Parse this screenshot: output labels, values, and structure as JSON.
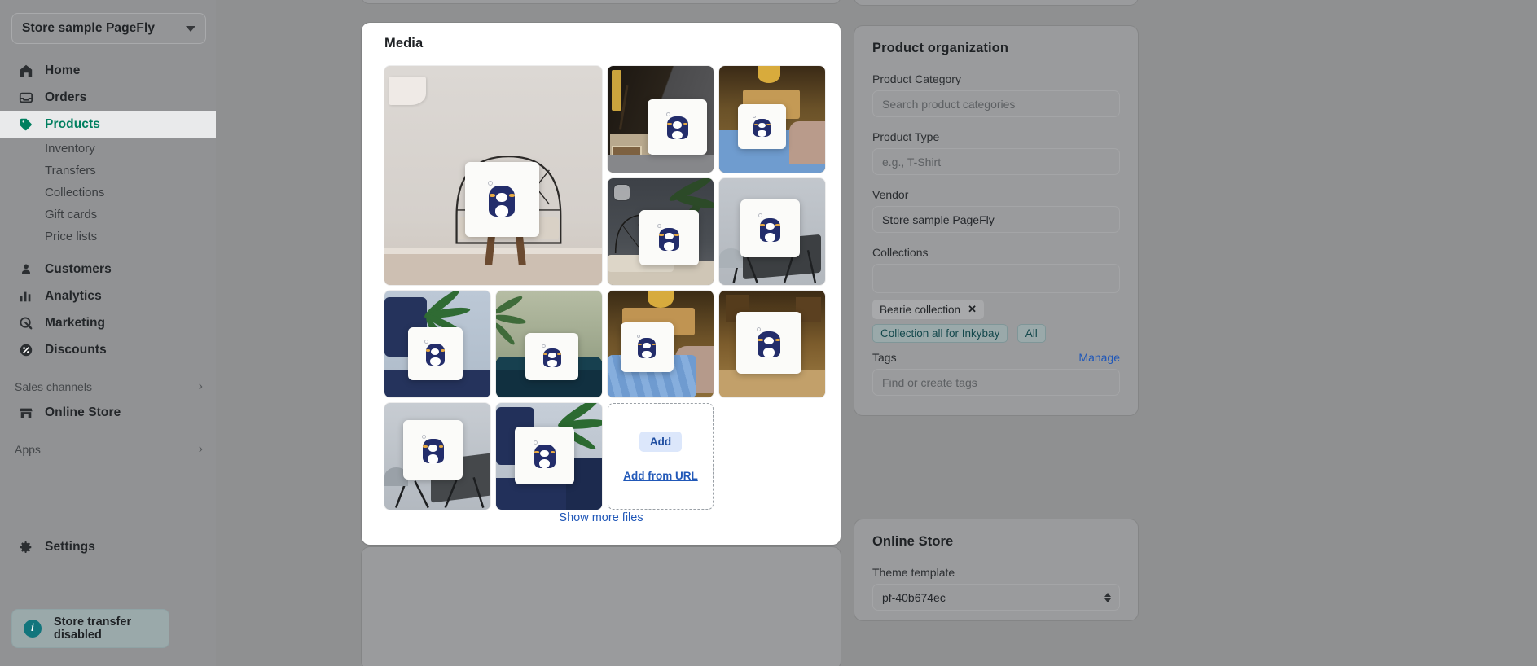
{
  "sidebar": {
    "store_switcher": {
      "name": "Store sample PageFly",
      "icon": "chevron-down-icon"
    },
    "primary_items": [
      {
        "label": "Home",
        "icon": "home-icon",
        "active": false
      },
      {
        "label": "Orders",
        "icon": "orders-icon",
        "active": false
      },
      {
        "label": "Products",
        "icon": "tag-icon",
        "active": true
      }
    ],
    "product_subitems": [
      {
        "label": "Inventory"
      },
      {
        "label": "Transfers"
      },
      {
        "label": "Collections"
      },
      {
        "label": "Gift cards"
      },
      {
        "label": "Price lists"
      }
    ],
    "secondary_items": [
      {
        "label": "Customers",
        "icon": "person-icon"
      },
      {
        "label": "Analytics",
        "icon": "bar-chart-icon"
      },
      {
        "label": "Marketing",
        "icon": "marketing-icon"
      },
      {
        "label": "Discounts",
        "icon": "discount-icon"
      }
    ],
    "sales_channels": {
      "label": "Sales channels",
      "chevron": "chevron-right-icon"
    },
    "channel_items": [
      {
        "label": "Online Store",
        "icon": "storefront-icon"
      }
    ],
    "apps": {
      "label": "Apps",
      "chevron": "chevron-right-icon"
    },
    "settings": {
      "label": "Settings",
      "icon": "gear-icon"
    },
    "notice": {
      "label": "Store transfer disabled",
      "icon": "info-icon",
      "icon_glyph": "i"
    }
  },
  "media": {
    "title": "Media",
    "show_more_label": "Show more files",
    "dropzone": {
      "add_label": "Add",
      "add_from_url_label": "Add from URL"
    },
    "tiles": [
      {
        "name": "pillow-on-wire-chair",
        "hero": true,
        "selected": false
      },
      {
        "name": "pillow-dark-damask-wall",
        "hero": false,
        "selected": false
      },
      {
        "name": "pillow-blue-knit-fireplace",
        "hero": false,
        "selected": false
      },
      {
        "name": "pillow-with-palm-dark",
        "hero": false,
        "selected": true
      },
      {
        "name": "pillow-on-grey-bench",
        "hero": false,
        "selected": false
      },
      {
        "name": "pillow-navy-sofa-plant",
        "hero": false,
        "selected": false
      },
      {
        "name": "pillow-green-wall-blanket",
        "hero": false,
        "selected": false
      },
      {
        "name": "pillow-blue-chunky-knit",
        "hero": false,
        "selected": false
      },
      {
        "name": "pillow-bookshelf-warm",
        "hero": false,
        "selected": false
      },
      {
        "name": "pillow-grey-metal-bench",
        "hero": false,
        "selected": false
      },
      {
        "name": "pillow-navy-armchair-plant",
        "hero": false,
        "selected": false
      }
    ]
  },
  "product_organization": {
    "title": "Product organization",
    "product_category": {
      "label": "Product Category",
      "value": "",
      "placeholder": "Search product categories"
    },
    "product_type": {
      "label": "Product Type",
      "value": "",
      "placeholder": "e.g., T-Shirt"
    },
    "vendor": {
      "label": "Vendor",
      "value": "Store sample PageFly",
      "placeholder": ""
    },
    "collections": {
      "label": "Collections",
      "value": "",
      "placeholder": "",
      "selected": [
        {
          "label": "Bearie collection",
          "remove_icon": "close-icon"
        }
      ],
      "suggestions": [
        {
          "label": "Collection all for Inkybay"
        },
        {
          "label": "All"
        }
      ]
    },
    "tags": {
      "label": "Tags",
      "manage_label": "Manage",
      "value": "",
      "placeholder": "Find or create tags"
    }
  },
  "online_store": {
    "title": "Online Store",
    "theme_template": {
      "label": "Theme template",
      "value": "pf-40b674ec",
      "icon": "select-arrows-icon"
    }
  },
  "colors": {
    "accent_green": "#007f5f",
    "link_blue": "#2158b8",
    "add_button_bg": "#dce7fb",
    "info_badge": "#12757c",
    "bear_navy": "#232d6b"
  }
}
